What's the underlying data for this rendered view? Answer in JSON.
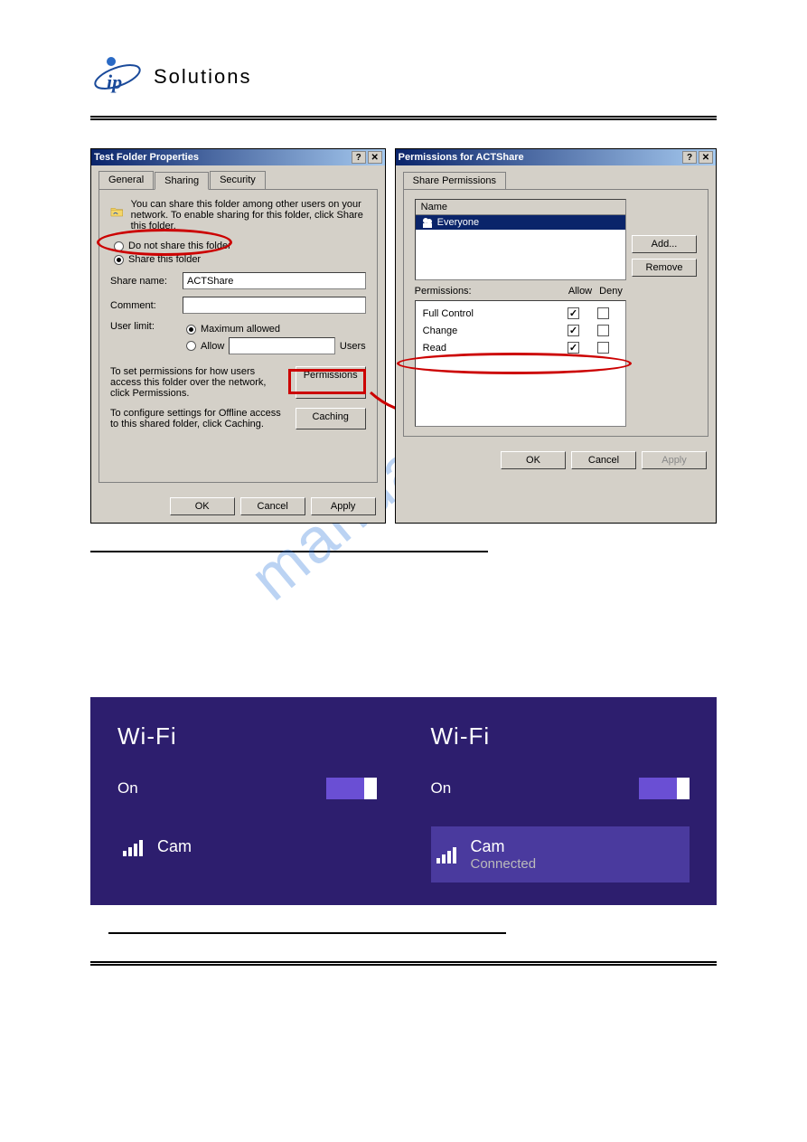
{
  "logo": {
    "brand": "Solutions"
  },
  "dialog1": {
    "title": "Test Folder Properties",
    "tabs": {
      "general": "General",
      "sharing": "Sharing",
      "security": "Security"
    },
    "desc": "You can share this folder among other users on your network. To enable sharing for this folder, click Share this folder.",
    "radio_no_share": "Do not share this folder",
    "radio_share": "Share this folder",
    "share_name_label": "Share name:",
    "share_name_value": "ACTShare",
    "comment_label": "Comment:",
    "comment_value": "",
    "user_limit_label": "User limit:",
    "max_allowed": "Maximum allowed",
    "allow": "Allow",
    "users_suffix": "Users",
    "perm_desc": "To set permissions for how users access this folder over the network, click Permissions.",
    "perm_btn": "Permissions",
    "cache_desc": "To configure settings for Offline access to this shared folder, click Caching.",
    "cache_btn": "Caching",
    "ok": "OK",
    "cancel": "Cancel",
    "apply": "Apply"
  },
  "dialog2": {
    "title": "Permissions for ACTShare",
    "tab": "Share Permissions",
    "name_hdr": "Name",
    "everyone": "Everyone",
    "add": "Add...",
    "remove": "Remove",
    "permissions_label": "Permissions:",
    "allow_hdr": "Allow",
    "deny_hdr": "Deny",
    "perms": [
      {
        "name": "Full Control",
        "allow": true,
        "deny": false
      },
      {
        "name": "Change",
        "allow": true,
        "deny": false
      },
      {
        "name": "Read",
        "allow": true,
        "deny": false
      }
    ],
    "ok": "OK",
    "cancel": "Cancel",
    "apply": "Apply"
  },
  "wifi": {
    "title": "Wi-Fi",
    "on": "On",
    "net_name": "Cam",
    "connected": "Connected"
  },
  "watermark": "manualshive.com"
}
